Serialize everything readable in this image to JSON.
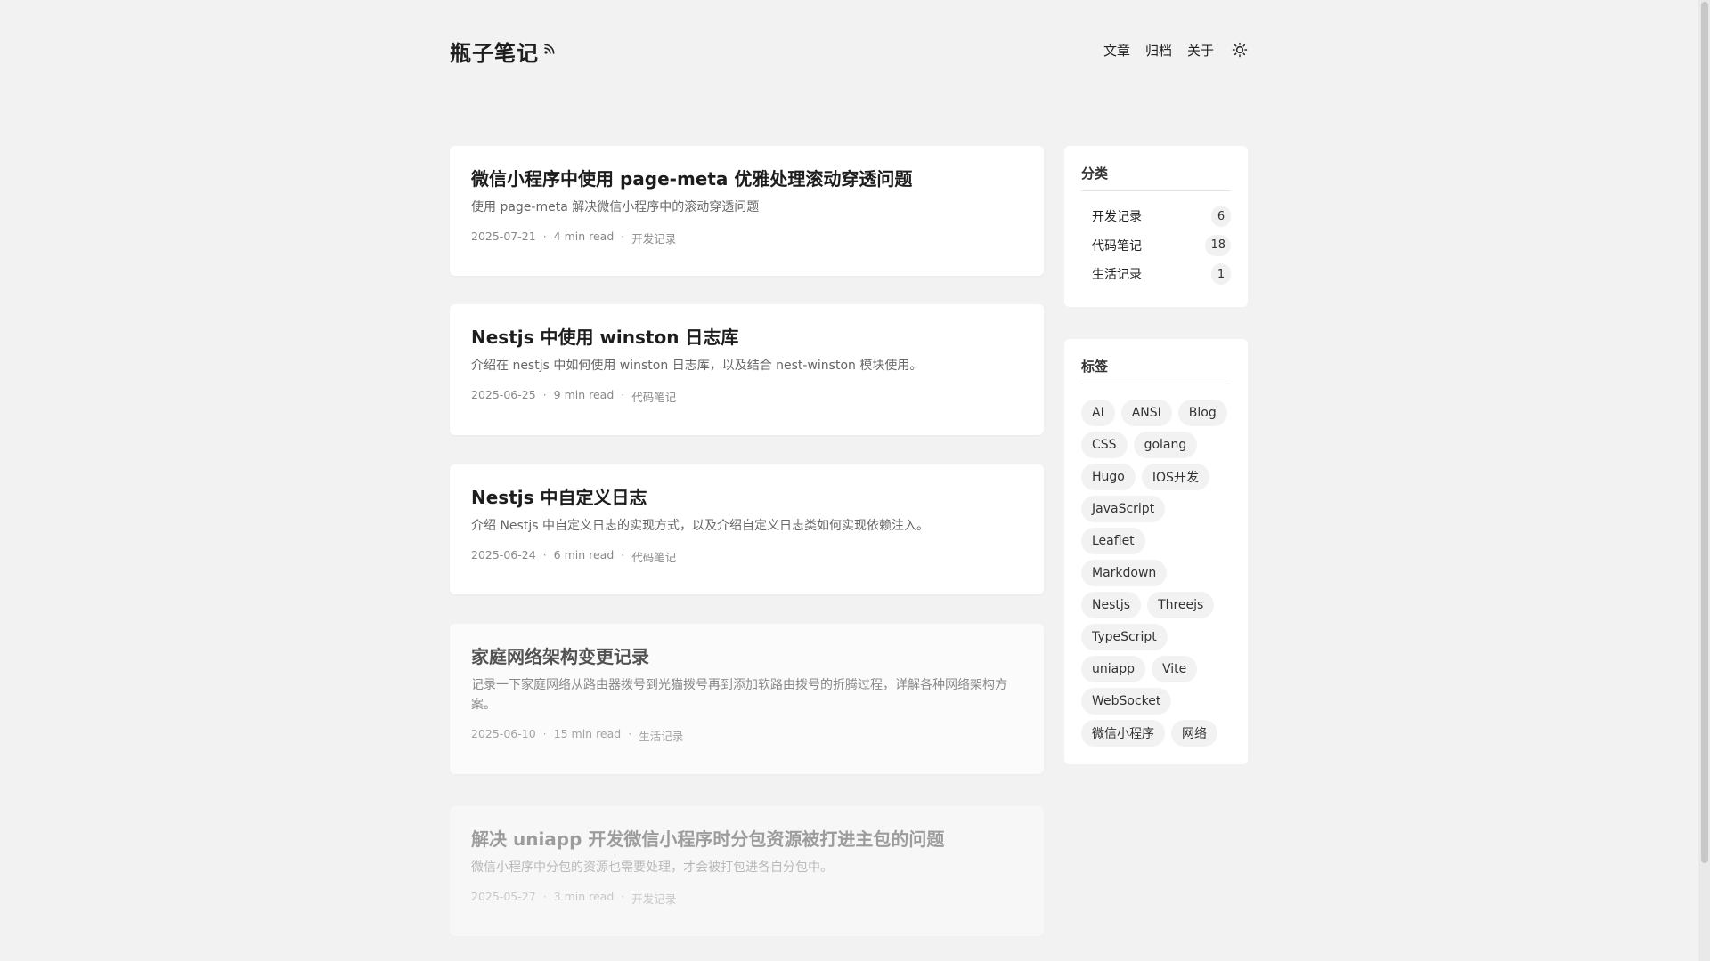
{
  "site": {
    "title": "瓶子笔记",
    "rss_icon": "rss-icon",
    "theme_icon": "sun-icon"
  },
  "nav": {
    "items": [
      "文章",
      "归档",
      "关于"
    ]
  },
  "posts": [
    {
      "title": "微信小程序中使用 page-meta 优雅处理滚动穿透问题",
      "summary": "使用 page-meta 解决微信小程序中的滚动穿透问题",
      "date": "2025-07-21",
      "read": "4 min read",
      "category": "开发记录",
      "opacity": 1
    },
    {
      "title": "Nestjs 中使用 winston 日志库",
      "summary": "介绍在 nestjs 中如何使用 winston 日志库，以及结合 nest-winston 模块使用。",
      "date": "2025-06-25",
      "read": "9 min read",
      "category": "代码笔记",
      "opacity": 1
    },
    {
      "title": "Nestjs 中自定义日志",
      "summary": "介绍 Nestjs 中自定义日志的实现方式，以及介绍自定义日志类如何实现依赖注入。",
      "date": "2025-06-24",
      "read": "6 min read",
      "category": "代码笔记",
      "opacity": 1
    },
    {
      "title": "家庭网络架构变更记录",
      "summary": "记录一下家庭网络从路由器拨号到光猫拨号再到添加软路由拨号的折腾过程，详解各种网络架构方案。",
      "date": "2025-06-10",
      "read": "15 min read",
      "category": "生活记录",
      "opacity": 0.75
    },
    {
      "title": "解决 uniapp 开发微信小程序时分包资源被打进主包的问题",
      "summary": "微信小程序中分包的资源也需要处理，才会被打包进各自分包中。",
      "date": "2025-05-27",
      "read": "3 min read",
      "category": "开发记录",
      "opacity": 0.4
    }
  ],
  "sidebar": {
    "categories": {
      "title": "分类",
      "items": [
        {
          "name": "开发记录",
          "count": "6"
        },
        {
          "name": "代码笔记",
          "count": "18"
        },
        {
          "name": "生活记录",
          "count": "1"
        }
      ]
    },
    "tags": {
      "title": "标签",
      "items": [
        "AI",
        "ANSI",
        "Blog",
        "CSS",
        "golang",
        "Hugo",
        "IOS开发",
        "JavaScript",
        "Leaflet",
        "Markdown",
        "Nestjs",
        "Threejs",
        "TypeScript",
        "uniapp",
        "Vite",
        "WebSocket",
        "微信小程序",
        "网络"
      ]
    }
  }
}
